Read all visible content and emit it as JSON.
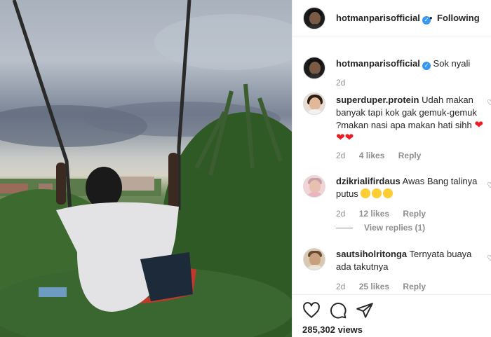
{
  "post": {
    "author": "hotmanparisofficial",
    "follow_state": "Following",
    "separator": "•",
    "caption": "Sok nyali",
    "caption_time": "2d",
    "views": "285,302 views"
  },
  "comments": [
    {
      "username": "superduper.protein",
      "text": "Udah makan banyak tapi kok gak gemuk-gemuk ?makan nasi apa makan hati sihh",
      "emoji": [
        "red-heart",
        "red-heart",
        "red-heart"
      ],
      "time": "2d",
      "likes": "4 likes",
      "reply": "Reply"
    },
    {
      "username": "dzikrialifirdaus",
      "text": "Awas Bang talinya putus",
      "emoji": [
        "rofl-face",
        "rofl-face",
        "grinning-sweat-face"
      ],
      "time": "2d",
      "likes": "12 likes",
      "reply": "Reply",
      "view_replies": "View replies (1)"
    },
    {
      "username": "sautsiholritonga",
      "text": "Ternyata buaya ada takutnya",
      "time": "2d",
      "likes": "25 likes",
      "reply": "Reply"
    }
  ],
  "icons": {
    "verified": "verified-badge-icon",
    "like": "heart-icon",
    "comment": "comment-bubble-icon",
    "share": "paper-plane-icon"
  },
  "colors": {
    "verified": "#3897f0",
    "meta_text": "#8e8e8e",
    "heart_emoji": "#ed1c24"
  }
}
